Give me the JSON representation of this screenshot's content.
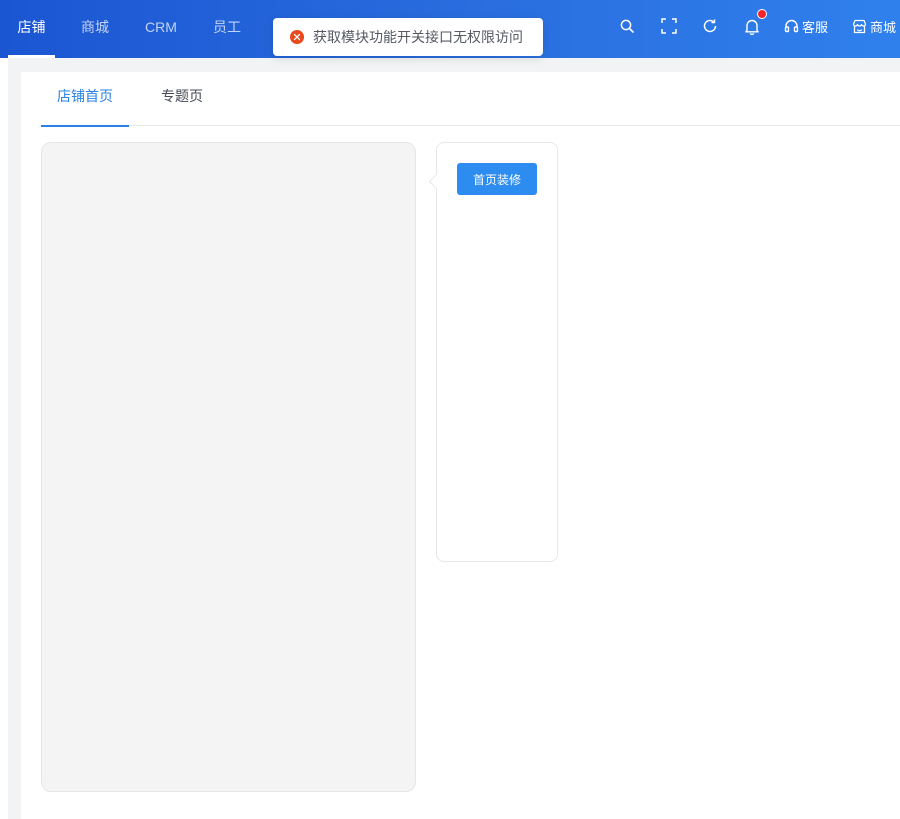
{
  "topnav": {
    "items": [
      {
        "label": "店铺",
        "active": true
      },
      {
        "label": "商城",
        "active": false
      },
      {
        "label": "CRM",
        "active": false
      },
      {
        "label": "员工",
        "active": false
      }
    ],
    "tools": {
      "search_icon": "search-icon",
      "fullscreen_icon": "fullscreen-icon",
      "refresh_icon": "refresh-icon",
      "bell_icon": "bell-icon",
      "service_label": "客服",
      "store_label": "商城"
    },
    "gradient": [
      "#1b56d2",
      "#2f80ed"
    ]
  },
  "toast": {
    "type": "error",
    "message": "获取模块功能开关接口无权限访问",
    "icon_color": "#e8491d"
  },
  "tabs": [
    {
      "label": "店铺首页",
      "active": true
    },
    {
      "label": "专题页",
      "active": false
    }
  ],
  "side_panel": {
    "button_label": "首页装修"
  },
  "colors": {
    "accent": "#2a82e4",
    "button": "#2d8cf0",
    "preview_bg": "#f4f4f4",
    "page_bg": "#f2f3f5"
  }
}
